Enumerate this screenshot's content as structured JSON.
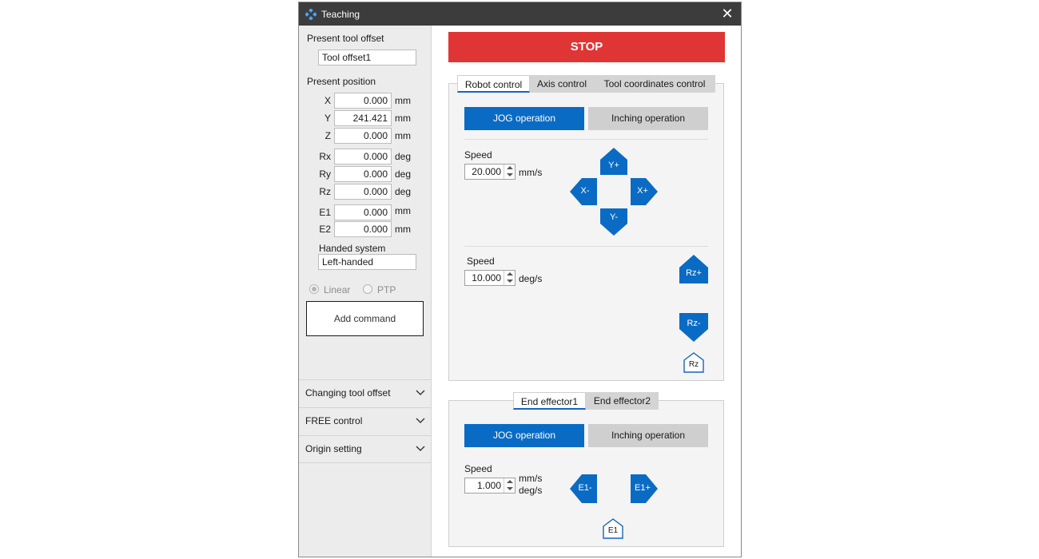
{
  "window": {
    "title": "Teaching",
    "close_glyph": "✕"
  },
  "left": {
    "present_tool_offset_label": "Present tool offset",
    "present_tool_offset_value": "Tool offset1",
    "present_position_label": "Present position",
    "positions": [
      {
        "axis": "X",
        "value": "0.000",
        "unit": "mm"
      },
      {
        "axis": "Y",
        "value": "241.421",
        "unit": "mm"
      },
      {
        "axis": "Z",
        "value": "0.000",
        "unit": "mm"
      },
      {
        "axis": "Rx",
        "value": "0.000",
        "unit": "deg"
      },
      {
        "axis": "Ry",
        "value": "0.000",
        "unit": "deg"
      },
      {
        "axis": "Rz",
        "value": "0.000",
        "unit": "deg"
      },
      {
        "axis": "E1",
        "value": "0.000",
        "unit": "mm"
      },
      {
        "axis": "E2",
        "value": "0.000",
        "unit": "mm"
      }
    ],
    "handed_system_label": "Handed system",
    "handed_system_value": "Left-handed",
    "radio_linear": "Linear",
    "radio_ptp": "PTP",
    "add_command": "Add command",
    "accordion": [
      {
        "label": "Changing tool offset"
      },
      {
        "label": "FREE control"
      },
      {
        "label": "Origin setting"
      }
    ]
  },
  "right": {
    "stop_label": "STOP",
    "tabs": [
      "Robot control",
      "Axis control",
      "Tool coordinates control"
    ],
    "jog_label": "JOG operation",
    "inching_label": "Inching operation",
    "speed_label": "Speed",
    "linear_speed": "20.000",
    "linear_unit": "mm/s",
    "rot_speed": "10.000",
    "rot_unit": "deg/s",
    "jog_buttons": {
      "y_plus": "Y+",
      "y_minus": "Y-",
      "x_plus": "X+",
      "x_minus": "X-",
      "rz_plus": "Rz+",
      "rz_minus": "Rz-"
    },
    "rz_home": "Rz",
    "ee_tabs": [
      "End effector1",
      "End effector2"
    ],
    "ee_speed": "1.000",
    "ee_unit_1": "mm/s",
    "ee_unit_2": "deg/s",
    "ee_buttons": {
      "minus": "E1-",
      "plus": "E1+"
    },
    "ee_home": "E1"
  },
  "colors": {
    "accent": "#0a6bc4",
    "stop": "#e03535",
    "titlebar": "#3c3c3c"
  },
  "icons": {
    "app": "teaching-app-icon",
    "chevron": "chevron-down-icon",
    "home": "home-icon"
  }
}
